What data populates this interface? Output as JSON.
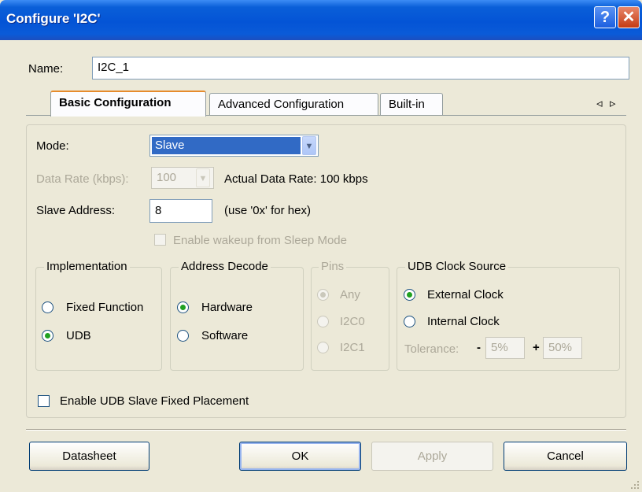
{
  "window": {
    "title": "Configure 'I2C'",
    "help_glyph": "?",
    "close_glyph": "✕"
  },
  "name_field": {
    "label": "Name:",
    "value": "I2C_1"
  },
  "tabs": [
    {
      "label": "Basic Configuration",
      "active": true
    },
    {
      "label": "Advanced Configuration",
      "active": false
    },
    {
      "label": "Built-in",
      "active": false
    }
  ],
  "tab_scroll": {
    "left": "◃",
    "right": "▹"
  },
  "basic": {
    "mode": {
      "label": "Mode:",
      "value": "Slave"
    },
    "data_rate": {
      "label": "Data Rate (kbps):",
      "value": "100",
      "actual": "Actual Data Rate: 100 kbps"
    },
    "slave_address": {
      "label": "Slave Address:",
      "value": "8",
      "hint": "(use '0x' for hex)"
    },
    "wakeup": {
      "label": "Enable wakeup from Sleep Mode",
      "checked": false
    }
  },
  "groups": {
    "implementation": {
      "title": "Implementation",
      "options": [
        "Fixed Function",
        "UDB"
      ],
      "selected": "UDB"
    },
    "address_decode": {
      "title": "Address Decode",
      "options": [
        "Hardware",
        "Software"
      ],
      "selected": "Hardware"
    },
    "pins": {
      "title": "Pins",
      "options": [
        "Any",
        "I2C0",
        "I2C1"
      ],
      "selected": "Any"
    },
    "udb_clock": {
      "title": "UDB Clock Source",
      "options": [
        "External Clock",
        "Internal Clock"
      ],
      "selected": "External Clock",
      "tolerance": {
        "label": "Tolerance:",
        "minus": "-",
        "minus_value": "5%",
        "plus": "+",
        "plus_value": "50%"
      }
    }
  },
  "fixed_placement": {
    "label": "Enable UDB Slave Fixed Placement",
    "checked": false
  },
  "buttons": {
    "datasheet": "Datasheet",
    "ok": "OK",
    "apply": "Apply",
    "cancel": "Cancel"
  },
  "colors": {
    "title_bar": "#0454d6",
    "selection": "#316ac5",
    "radio_dot": "#21a121",
    "tab_accent": "#e68b2c"
  }
}
